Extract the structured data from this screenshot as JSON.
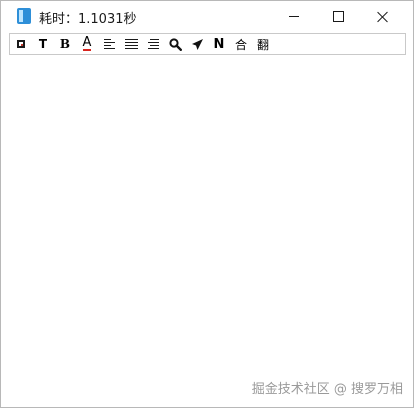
{
  "window": {
    "title": "耗时：1.1031秒",
    "icon": "app-book-icon"
  },
  "controls": {
    "minimize_icon": "minimize-icon",
    "maximize_icon": "maximize-icon",
    "close_icon": "close-icon"
  },
  "toolbar": {
    "items": [
      {
        "name": "frame-icon"
      },
      {
        "label": "T"
      },
      {
        "label": "B"
      },
      {
        "label": "A",
        "underline_color": "#d8241e"
      },
      {
        "name": "align-left-icon"
      },
      {
        "name": "align-justify-icon"
      },
      {
        "name": "align-right-icon"
      },
      {
        "name": "search-icon"
      },
      {
        "name": "send-icon"
      },
      {
        "label": "N"
      },
      {
        "label": "合"
      },
      {
        "label": "翻"
      }
    ]
  },
  "watermark": "掘金技术社区 @ 搜罗万相"
}
